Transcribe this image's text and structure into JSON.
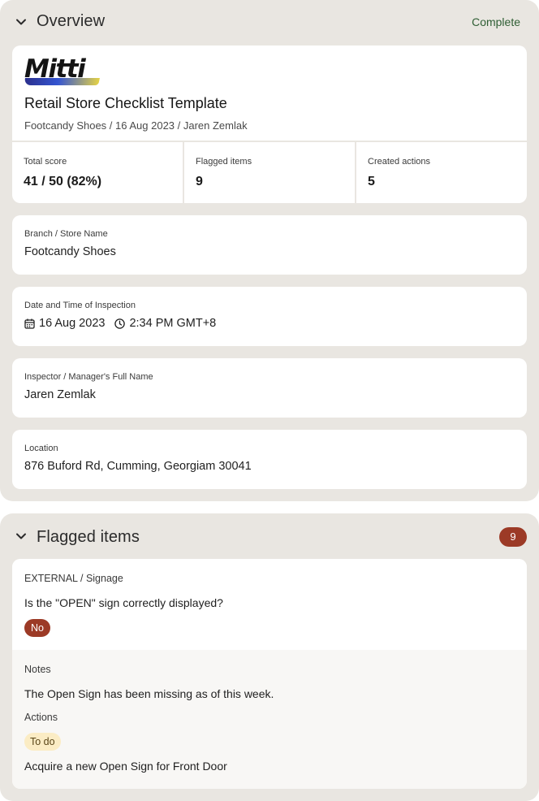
{
  "overview": {
    "title": "Overview",
    "status": "Complete",
    "logo_text": "Mitti",
    "template_title": "Retail Store Checklist Template",
    "subtitle": "Footcandy Shoes / 16 Aug 2023 / Jaren Zemlak",
    "scores": [
      {
        "label": "Total score",
        "value": "41 / 50 (82%)"
      },
      {
        "label": "Flagged items",
        "value": "9"
      },
      {
        "label": "Created actions",
        "value": "5"
      }
    ],
    "fields": {
      "branch": {
        "label": "Branch / Store Name",
        "value": "Footcandy Shoes"
      },
      "datetime": {
        "label": "Date and Time of Inspection",
        "date": "16 Aug 2023",
        "time": "2:34 PM GMT+8"
      },
      "inspector": {
        "label": "Inspector / Manager's Full Name",
        "value": "Jaren Zemlak"
      },
      "location": {
        "label": "Location",
        "value": "876 Buford Rd, Cumming, Georgiam 30041"
      }
    }
  },
  "flagged": {
    "title": "Flagged items",
    "count": "9",
    "item": {
      "category": "EXTERNAL / Signage",
      "question": "Is the \"OPEN\" sign correctly displayed?",
      "answer": "No",
      "notes_label": "Notes",
      "notes": "The Open Sign has been missing as of this week.",
      "actions_label": "Actions",
      "action_status": "To do",
      "action_text": "Acquire a new Open Sign for Front Door"
    }
  },
  "colors": {
    "section_bg": "#e9e6e1",
    "complete_green": "#2f5e34",
    "flag_red": "#9c3a26",
    "todo_yellow": "#fbecc4"
  },
  "icons": [
    "chevron-down-icon",
    "calendar-icon",
    "clock-icon"
  ]
}
